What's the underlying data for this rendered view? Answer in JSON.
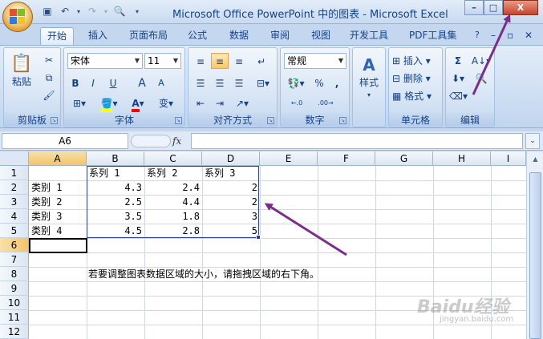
{
  "window": {
    "title": "Microsoft Office PowerPoint 中的图表 - Microsoft Excel",
    "controls": {
      "minimize": "–",
      "restore": "□",
      "close": "X"
    }
  },
  "quick_access": [
    "save-icon",
    "undo-icon",
    "redo-icon",
    "print-preview-icon",
    "customize-icon"
  ],
  "tabs": [
    "开始",
    "插入",
    "页面布局",
    "公式",
    "数据",
    "审阅",
    "视图",
    "开发工具",
    "PDF工具集"
  ],
  "ribbon": {
    "clipboard": {
      "label": "剪贴板",
      "paste": "粘贴"
    },
    "font": {
      "label": "字体",
      "name": "宋体",
      "size": "11",
      "bold": "B",
      "italic": "I",
      "underline": "U",
      "grow": "A",
      "shrink": "A",
      "fill_color": "#ffff00",
      "font_color": "#ff0000",
      "phonetic": "变"
    },
    "alignment": {
      "label": "对齐方式"
    },
    "number": {
      "label": "数字",
      "format": "常规",
      "percent": "%",
      "comma": ",",
      "inc_decimal": ".0→.00",
      "dec_decimal": ".00→.0"
    },
    "styles": {
      "label": "样式"
    },
    "cells": {
      "label": "单元格",
      "insert": "插入",
      "delete": "删除",
      "format": "格式"
    },
    "editing": {
      "label": "编辑",
      "sum": "Σ"
    }
  },
  "formula_bar": {
    "name_box": "A6",
    "fx": "fx",
    "value": ""
  },
  "sheet": {
    "columns": [
      "A",
      "B",
      "C",
      "D",
      "E",
      "F",
      "G",
      "H",
      "I"
    ],
    "rows": [
      "1",
      "2",
      "3",
      "4",
      "5",
      "6",
      "7",
      "8",
      "9",
      "10",
      "11",
      "12"
    ],
    "header_row": [
      "",
      "系列 1",
      "系列 2",
      "系列 3"
    ],
    "data_rows": [
      {
        "label": "类别 1",
        "values": [
          "4.3",
          "2.4",
          "2"
        ]
      },
      {
        "label": "类别 2",
        "values": [
          "2.5",
          "4.4",
          "2"
        ]
      },
      {
        "label": "类别 3",
        "values": [
          "3.5",
          "1.8",
          "3"
        ]
      },
      {
        "label": "类别 4",
        "values": [
          "4.5",
          "2.8",
          "5"
        ]
      }
    ],
    "note": "若要调整图表数据区域的大小，请拖拽区域的右下角。"
  },
  "watermark": {
    "logo": "Baidu经验",
    "url": "jingyan.baidu.com"
  },
  "annotation_color": "#7b2d8e"
}
